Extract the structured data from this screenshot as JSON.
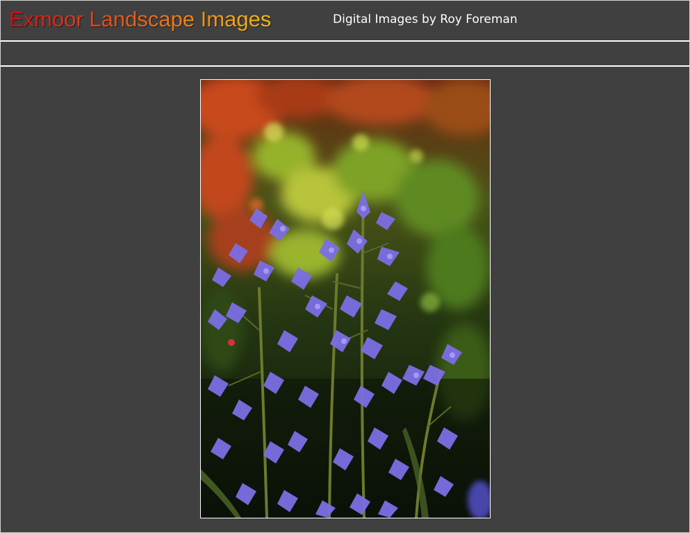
{
  "header": {
    "title": "Exmoor Landscape Images",
    "subtitle": "Digital Images by Roy Foreman"
  },
  "photo": {
    "subject": "bluebell-flowers-photo"
  },
  "colors": {
    "background": "#404040",
    "rule": "#ffffff",
    "title_gradient_start": "#cc0f15",
    "title_gradient_end": "#f3bc16",
    "subtitle": "#ffffff"
  }
}
